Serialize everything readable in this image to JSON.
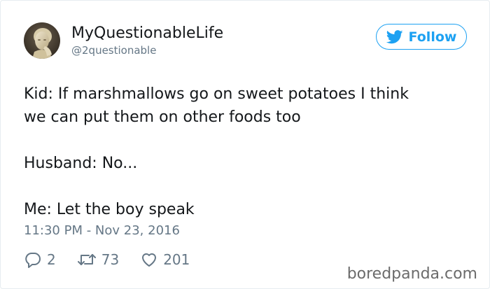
{
  "author": {
    "display_name": "MyQuestionableLife",
    "handle": "@2questionable",
    "avatar_icon": "statue-portrait-avatar"
  },
  "follow": {
    "label": "Follow",
    "icon": "twitter-bird-icon",
    "color": "#1da1f2"
  },
  "tweet": {
    "lines": [
      "Kid: If marshmallows go on sweet potatoes I think",
      "we can put them on other foods too",
      "Husband: No...",
      "Me: Let the boy speak"
    ],
    "timestamp": "11:30 PM - Nov 23, 2016"
  },
  "actions": {
    "replies": {
      "icon": "reply-icon",
      "count": "2"
    },
    "retweets": {
      "icon": "retweet-icon",
      "count": "73"
    },
    "likes": {
      "icon": "heart-icon",
      "count": "201"
    }
  },
  "watermark": "boredpanda.com",
  "colors": {
    "text": "#14171a",
    "muted": "#657786",
    "accent": "#1da1f2"
  }
}
